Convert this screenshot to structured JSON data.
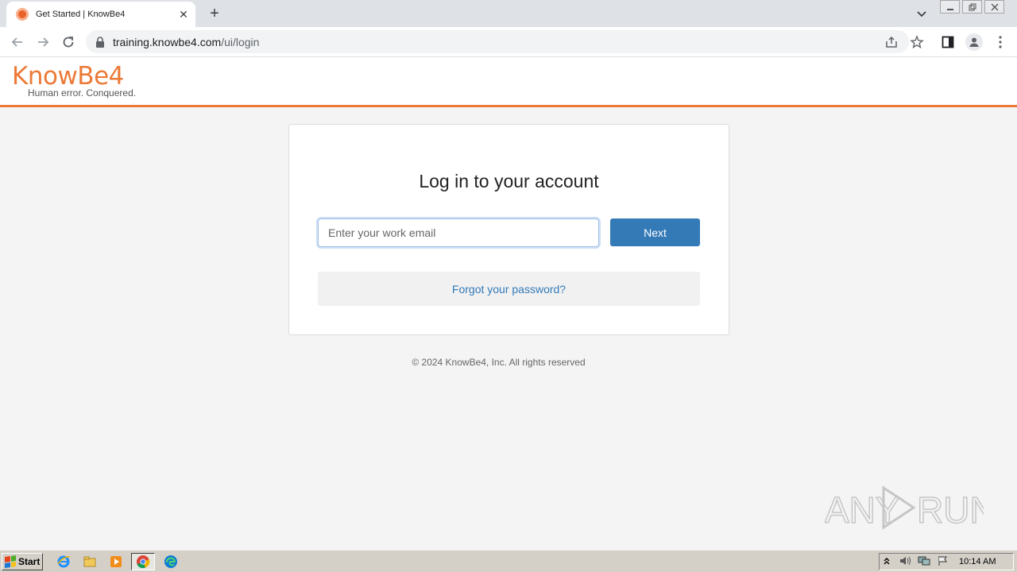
{
  "browser": {
    "tab_title": "Get Started | KnowBe4",
    "tab_close": "✕",
    "new_tab": "+",
    "url_host": "training.knowbe4.com",
    "url_path": "/ui/login"
  },
  "header": {
    "logo_main": "KnowBe4",
    "logo_tagline": "Human error. Conquered."
  },
  "login": {
    "title": "Log in to your account",
    "email_placeholder": "Enter your work email",
    "email_value": "",
    "next_label": "Next",
    "forgot_label": "Forgot your password?"
  },
  "footer": {
    "text": "© 2024 KnowBe4, Inc. All rights reserved"
  },
  "watermark": {
    "text_left": "ANY",
    "text_right": "RUN"
  },
  "taskbar": {
    "start_label": "Start",
    "clock": "10:14 AM"
  },
  "colors": {
    "brand_orange": "#ec7a37",
    "button_blue": "#337ab7"
  }
}
